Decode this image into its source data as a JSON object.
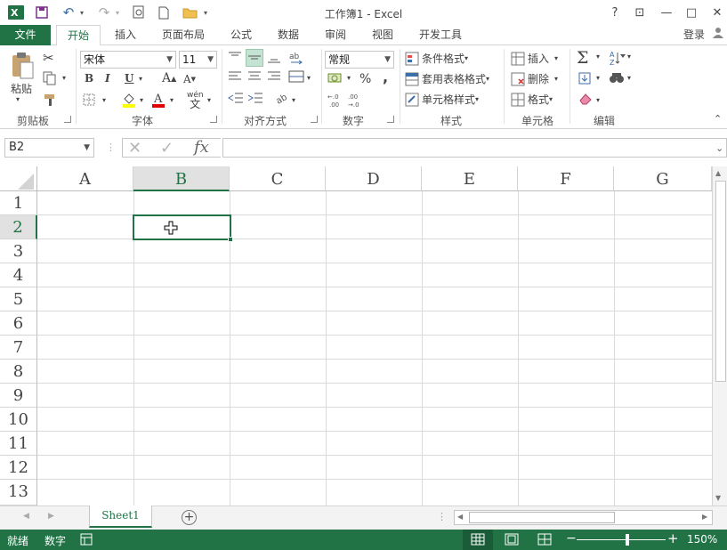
{
  "title": "工作簿1 - Excel",
  "colors": {
    "accent": "#217346",
    "status_bg": "#217346"
  },
  "qat": {
    "app_icon": "excel-icon",
    "save_icon": "save-icon",
    "undo_icon": "undo-icon",
    "redo_icon": "redo-icon",
    "print_preview_icon": "print-preview-icon",
    "new_icon": "new-file-icon",
    "open_icon": "open-folder-icon"
  },
  "window": {
    "help": "?",
    "restore_ribbon": "⊡",
    "minimize": "—",
    "maximize": "□",
    "close": "✕"
  },
  "tabs": [
    {
      "label": "文件"
    },
    {
      "label": "开始"
    },
    {
      "label": "插入"
    },
    {
      "label": "页面布局"
    },
    {
      "label": "公式"
    },
    {
      "label": "数据"
    },
    {
      "label": "审阅"
    },
    {
      "label": "视图"
    },
    {
      "label": "开发工具"
    }
  ],
  "signin": "登录",
  "ribbon": {
    "clipboard": {
      "paste": "粘贴",
      "label": "剪贴板"
    },
    "font": {
      "name": "宋体",
      "size": "11",
      "bold": "B",
      "italic": "I",
      "underline": "U",
      "grow": "A",
      "shrink": "A",
      "wen": "wén",
      "wen_char": "文",
      "label": "字体"
    },
    "align": {
      "label": "对齐方式"
    },
    "number": {
      "format": "常规",
      "percent": "%",
      "comma": ",",
      "label": "数字"
    },
    "styles": {
      "cond": "条件格式",
      "table": "套用表格格式",
      "cell": "单元格样式",
      "label": "样式"
    },
    "cells": {
      "insert": "插入",
      "delete": "删除",
      "format": "格式",
      "label": "单元格"
    },
    "editing": {
      "sum": "Σ",
      "label": "编辑"
    }
  },
  "formula": {
    "namebox": "B2",
    "cancel": "✕",
    "enter": "✓",
    "fx": "fx",
    "value": ""
  },
  "columns": [
    "A",
    "B",
    "C",
    "D",
    "E",
    "F",
    "G"
  ],
  "rows": [
    "1",
    "2",
    "3",
    "4",
    "5",
    "6",
    "7",
    "8",
    "9",
    "10",
    "11",
    "12",
    "13"
  ],
  "selected": {
    "col": "B",
    "row": "2"
  },
  "sheets": [
    {
      "name": "Sheet1"
    }
  ],
  "status": {
    "ready": "就绪",
    "mode": "数字",
    "zoom": "150%",
    "minus": "−",
    "plus": "+"
  }
}
